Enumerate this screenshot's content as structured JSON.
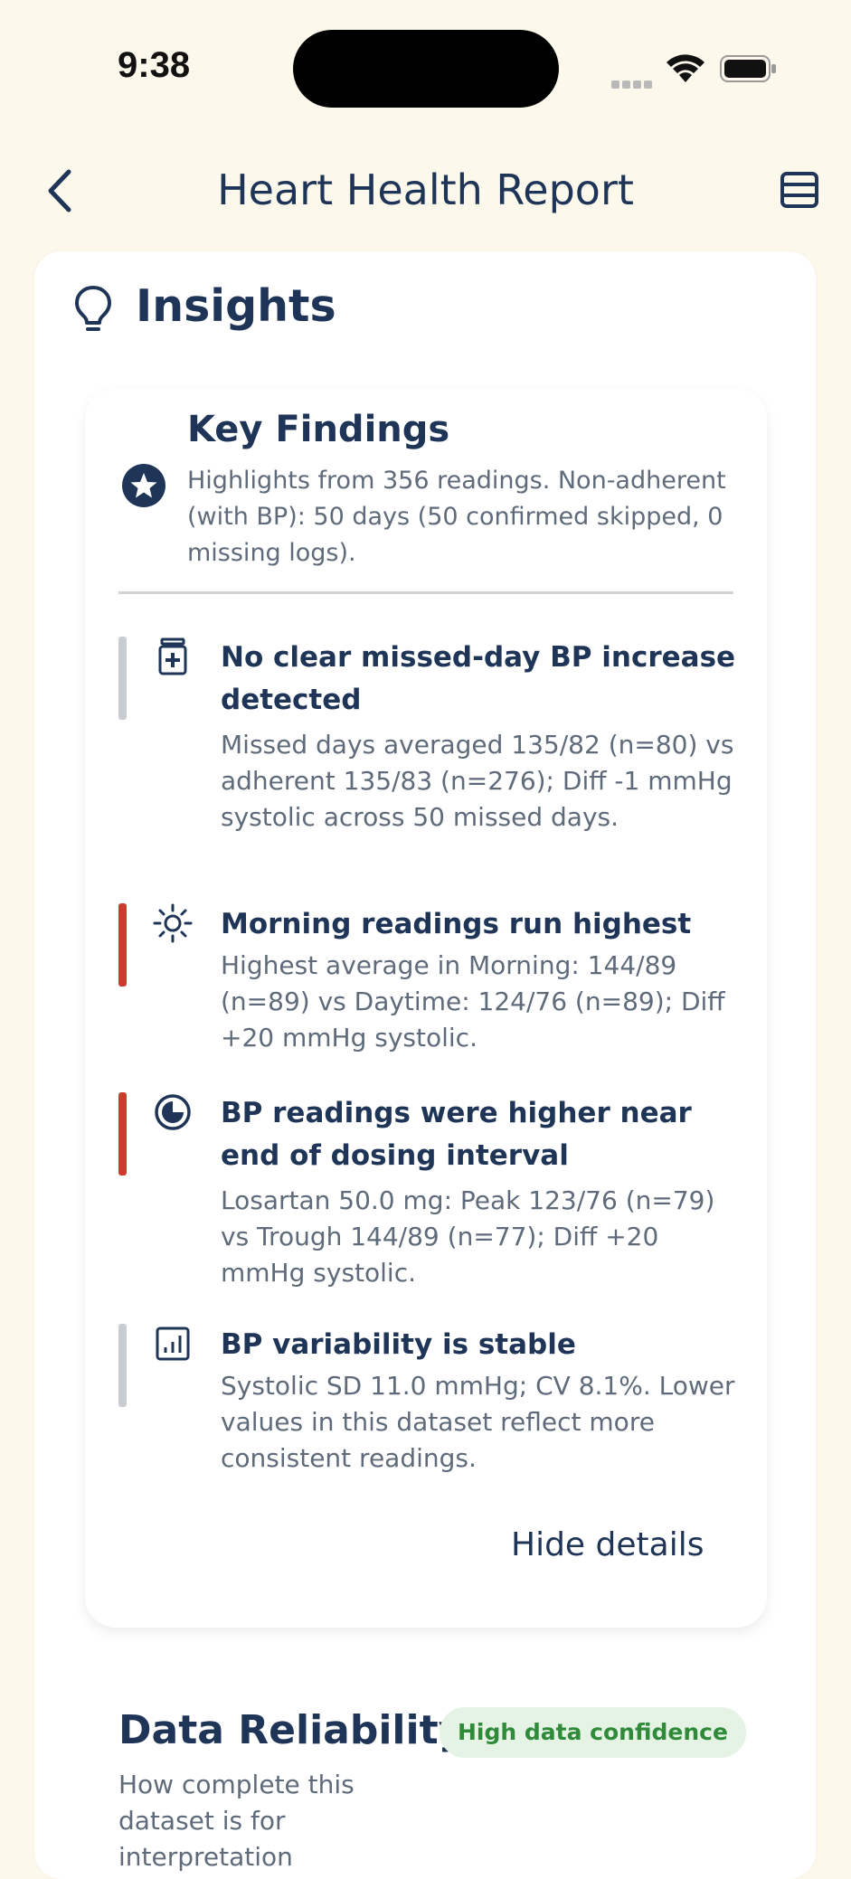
{
  "status_bar": {
    "time": "9:38"
  },
  "header": {
    "title": "Heart Health Report"
  },
  "insights": {
    "title": "Insights",
    "key_findings": {
      "title": "Key Findings",
      "subtitle": "Highlights from 356 readings. Non-adherent (with BP): 50 days (50 confirmed skipped, 0 missing logs).",
      "items": [
        {
          "icon": "pill-bottle-icon",
          "accent": "#c9ccd1",
          "title": "No clear missed-day BP increase detected",
          "body": "Missed days averaged 135/82 (n=80) vs adherent 135/83 (n=276); Diff -1 mmHg systolic across 50 missed days."
        },
        {
          "icon": "sun-icon",
          "accent": "#d0392e",
          "title": "Morning readings run highest",
          "body": "Highest average in Morning: 144/89 (n=89) vs Daytime: 124/76 (n=89); Diff +20 mmHg systolic."
        },
        {
          "icon": "half-moon-icon",
          "accent": "#d0392e",
          "title": "BP readings were higher near end of dosing interval",
          "body": "Losartan 50.0 mg: Peak 123/76 (n=79) vs Trough 144/89 (n=77); Diff +20 mmHg systolic."
        },
        {
          "icon": "bar-chart-icon",
          "accent": "#c9ccd1",
          "title": "BP variability is stable",
          "body": "Systolic SD 11.0 mmHg; CV 8.1%. Lower values in this dataset reflect more consistent readings."
        }
      ],
      "hide_label": "Hide details"
    }
  },
  "data_reliability": {
    "title": "Data Reliability",
    "badge": "High data confidence",
    "badge_color": "#2f8a3a",
    "subtitle": "How complete this dataset is for interpretation"
  }
}
